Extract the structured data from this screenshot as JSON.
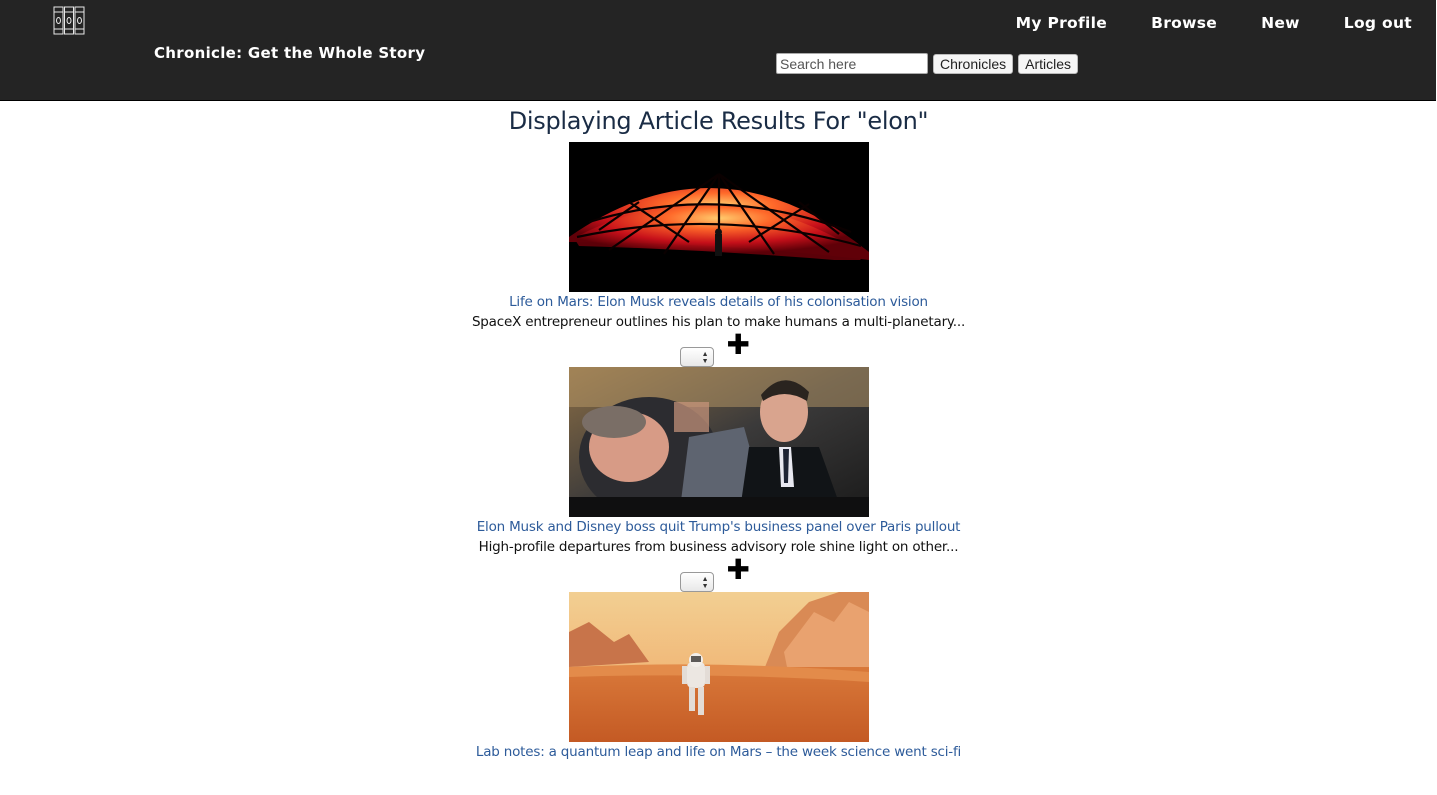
{
  "header": {
    "brand": "Chronicle: Get the Whole Story",
    "logo_icon": "bookshelf-icon",
    "nav": [
      "My Profile",
      "Browse",
      "New",
      "Log out"
    ],
    "search": {
      "placeholder": "Search here",
      "value": "",
      "chronicles_label": "Chronicles",
      "articles_label": "Articles"
    }
  },
  "main": {
    "heading": "Displaying Article Results For \"elon\"",
    "articles": [
      {
        "title": "Life on Mars: Elon Musk reveals details of his colonisation vision",
        "summary": "SpaceX entrepreneur outlines his plan to make humans a multi-planetary...",
        "image": "red-dome-mars-habitat"
      },
      {
        "title": "Elon Musk and Disney boss quit Trump's business panel over Paris pullout",
        "summary": "High-profile departures from business advisory role shine light on other...",
        "image": "elon-musk-meeting-photo"
      },
      {
        "title": "Lab notes: a quantum leap and life on Mars – the week science went sci-fi",
        "summary": "",
        "image": "astronaut-on-mars"
      }
    ],
    "add_icon": "plus-icon",
    "select_icon": "updown-arrows-icon"
  },
  "colors": {
    "topbar": "#242424",
    "link": "#2d5b9a",
    "heading": "#1a2c45"
  }
}
